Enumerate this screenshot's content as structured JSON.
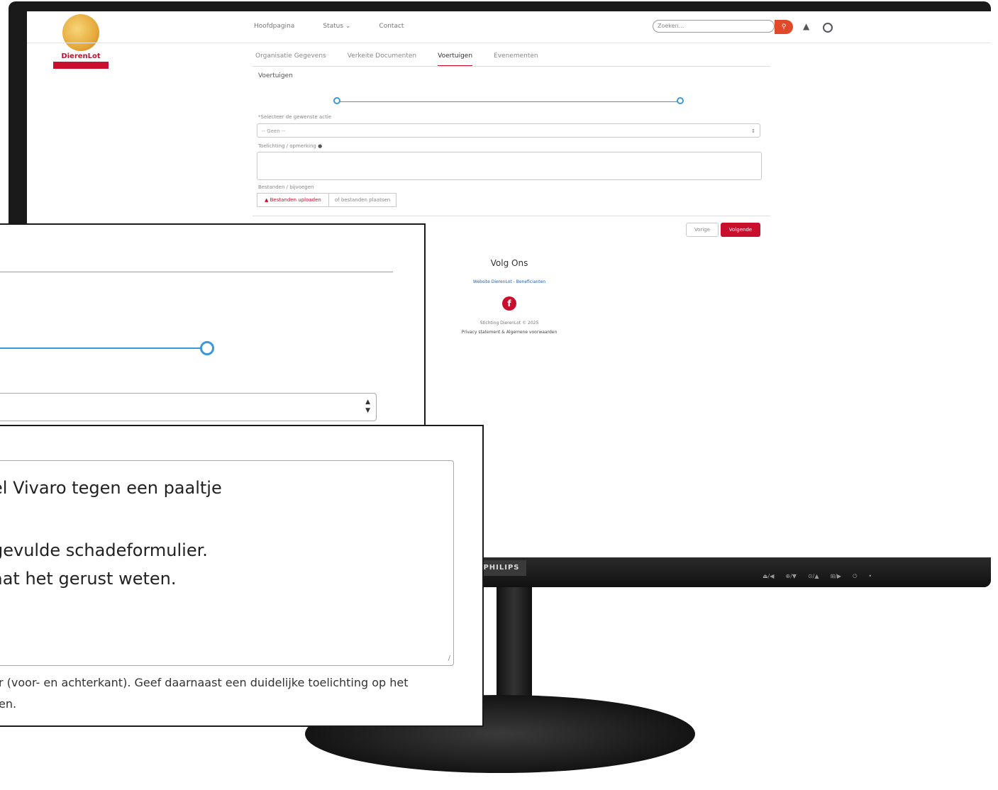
{
  "site": {
    "logo_name": "DierenLot",
    "logo_badge": "",
    "nav": [
      "Hoofdpagina",
      "Status ⌄",
      "Contact"
    ],
    "search_placeholder": "Zoeken...",
    "tabs": [
      "Organisatie Gegevens",
      "Verkeite Documenten",
      "Voertuigen",
      "Evenementen"
    ],
    "active_tab": "Voertuigen",
    "section_title": "Voertuigen",
    "select_label": "*Selecteer de gewenste actie",
    "select_value": "-- Geen --",
    "textarea_label": "Toelichting / opmerking",
    "upload_label": "Bestanden / bijvoegen",
    "upload_button": "Bestanden uploaden",
    "drop_text": "of bestanden plaatsen",
    "prev_button": "Vorige",
    "next_button": "Volgende",
    "footer_title": "Volg Ons",
    "footer_links": "Website DierenLot - Beneficianten",
    "footer_fb": "f",
    "footer_copy": "Stichting DierenLot © 2025",
    "footer_privacy": "Privacy statement & Algemene voorwaarden"
  },
  "monitor": {
    "brand": "PHILIPS",
    "osd": [
      "⏏/◀",
      "⊕/▼",
      "⊙/▲",
      "⊞/▶",
      "⏻",
      "•"
    ]
  },
  "zoom": {
    "textarea_lines": [
      "el Vivaro tegen een paaltje",
      "",
      "gevulde schadeformulier.",
      "aat het gerust weten."
    ],
    "help_lines": [
      "r (voor- en achterkant). Geef daarnaast een duidelijke toelichting op het",
      "en."
    ]
  },
  "colors": {
    "brand_red": "#c8102e",
    "step_blue": "#3a9ad9",
    "search_orange": "#e04a2a"
  }
}
